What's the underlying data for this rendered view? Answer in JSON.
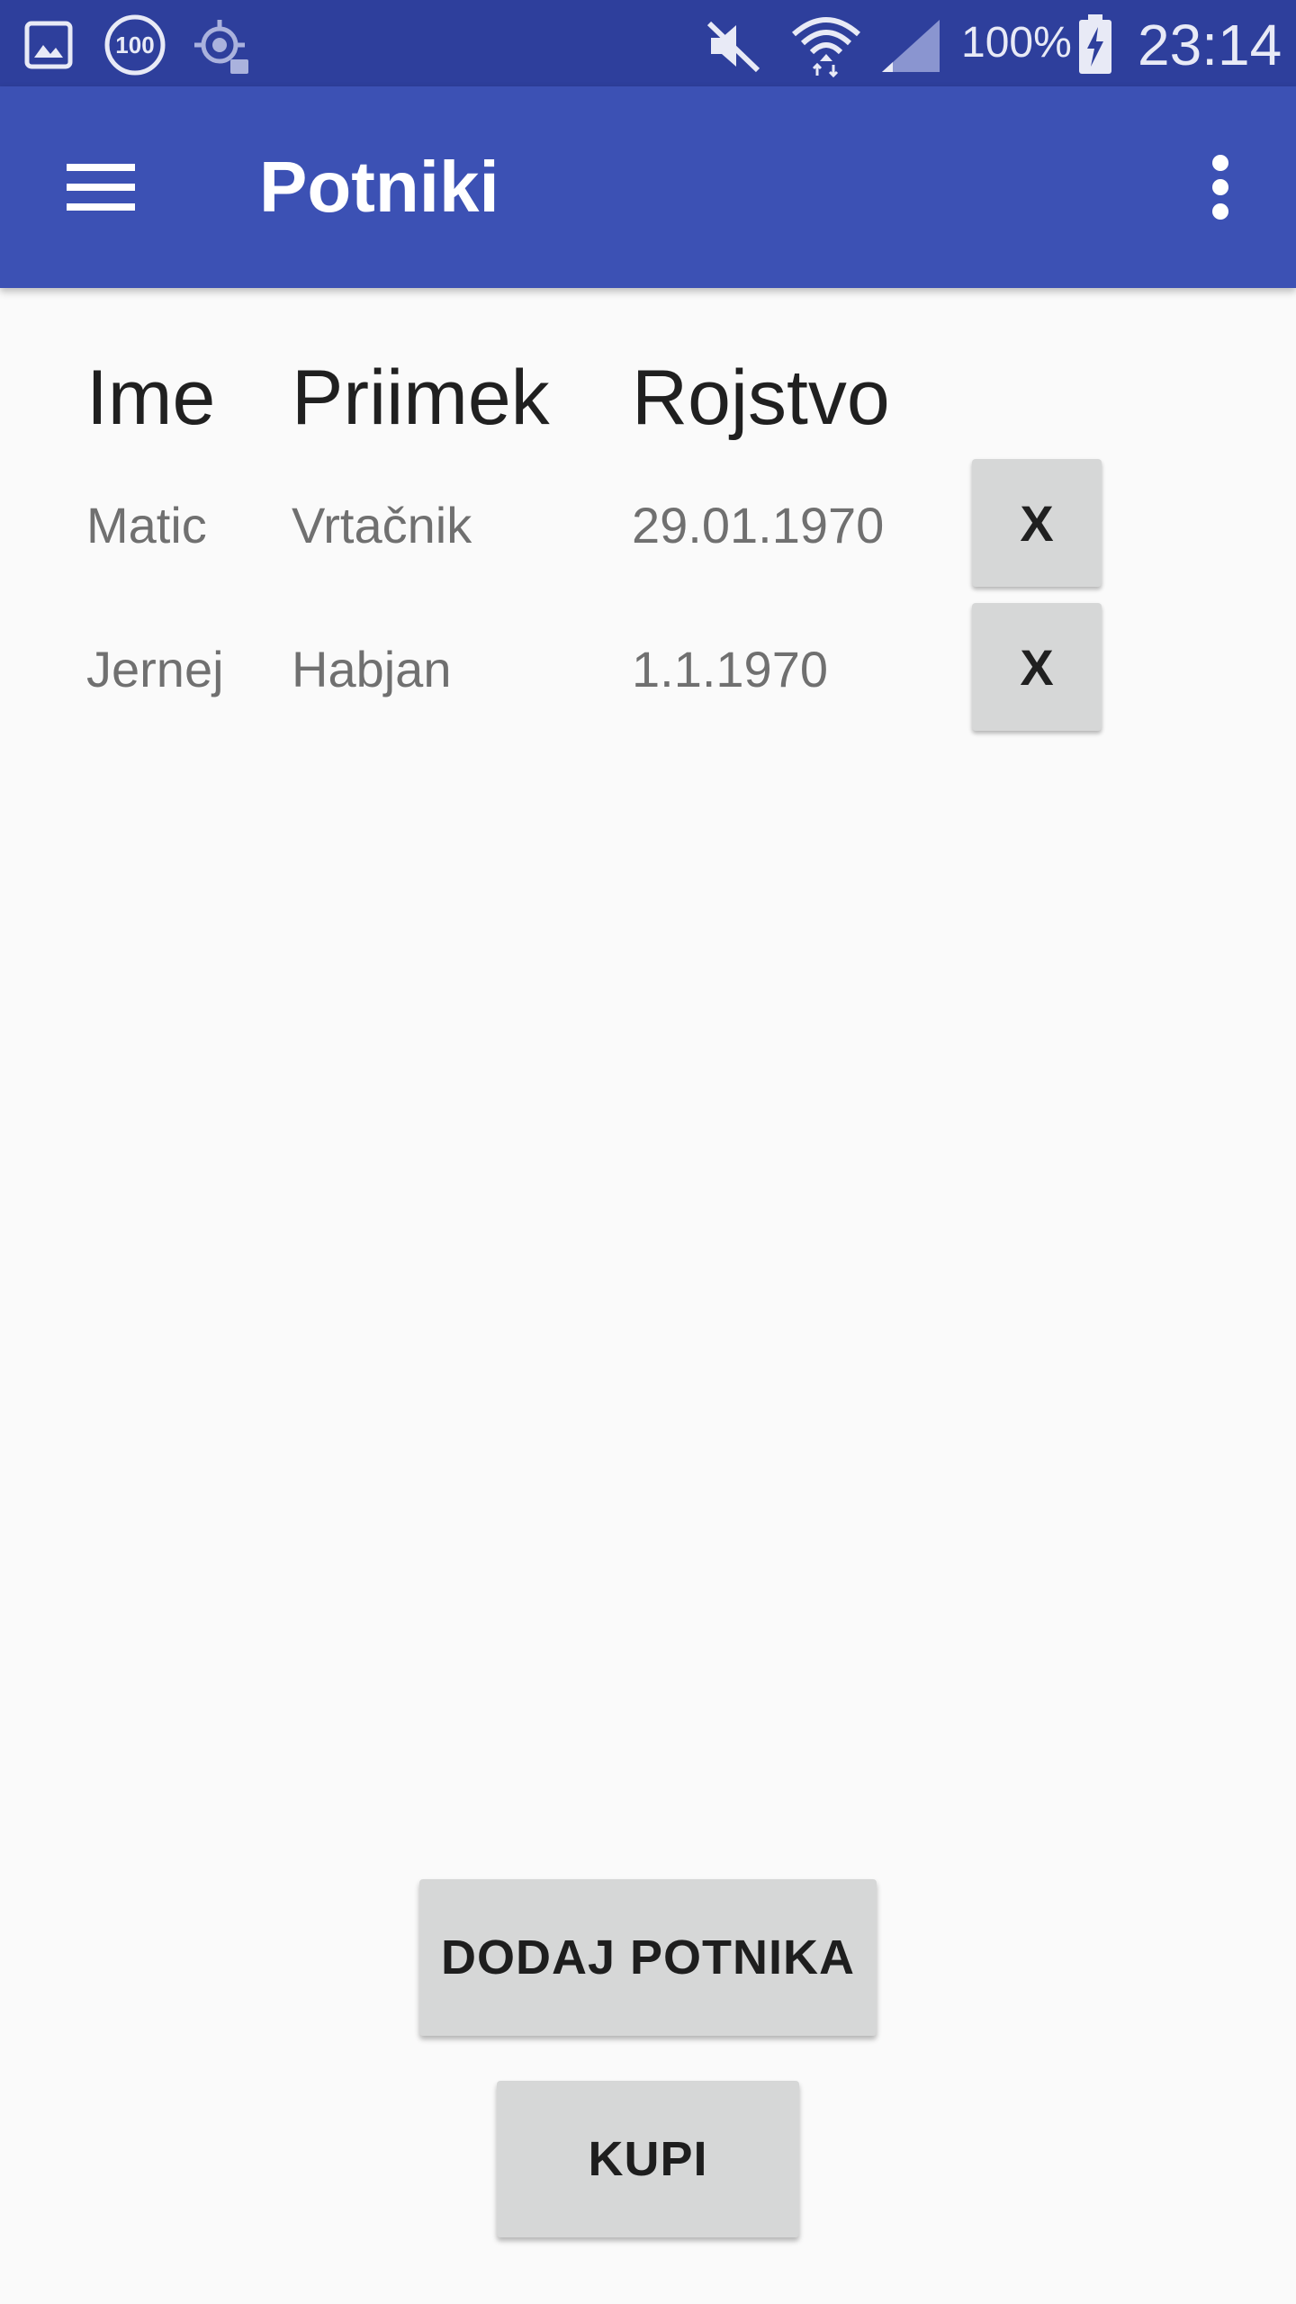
{
  "status_bar": {
    "battery_percent": "100%",
    "time": "23:14",
    "notification_badge": "100",
    "icons": [
      "gallery-icon",
      "badge-100-icon",
      "location-icon",
      "mute-icon",
      "wifi-icon",
      "signal-icon",
      "battery-charging-icon"
    ]
  },
  "app_bar": {
    "title": "Potniki",
    "left_icon": "menu-icon",
    "right_icon": "more-vert-icon"
  },
  "table": {
    "headers": [
      "Ime",
      "Priimek",
      "Rojstvo"
    ],
    "rows": [
      {
        "first_name": "Matic",
        "last_name": "Vrtačnik",
        "birth": "29.01.1970",
        "remove_label": "X"
      },
      {
        "first_name": "Jernej",
        "last_name": "Habjan",
        "birth": "1.1.1970",
        "remove_label": "X"
      }
    ]
  },
  "actions": {
    "add_label": "DODAJ POTNIKA",
    "buy_label": "KUPI"
  },
  "colors": {
    "status_bar": "#2e3f9c",
    "app_bar": "#3c51b4",
    "background": "#fafafa",
    "button": "#d6d7d7"
  }
}
